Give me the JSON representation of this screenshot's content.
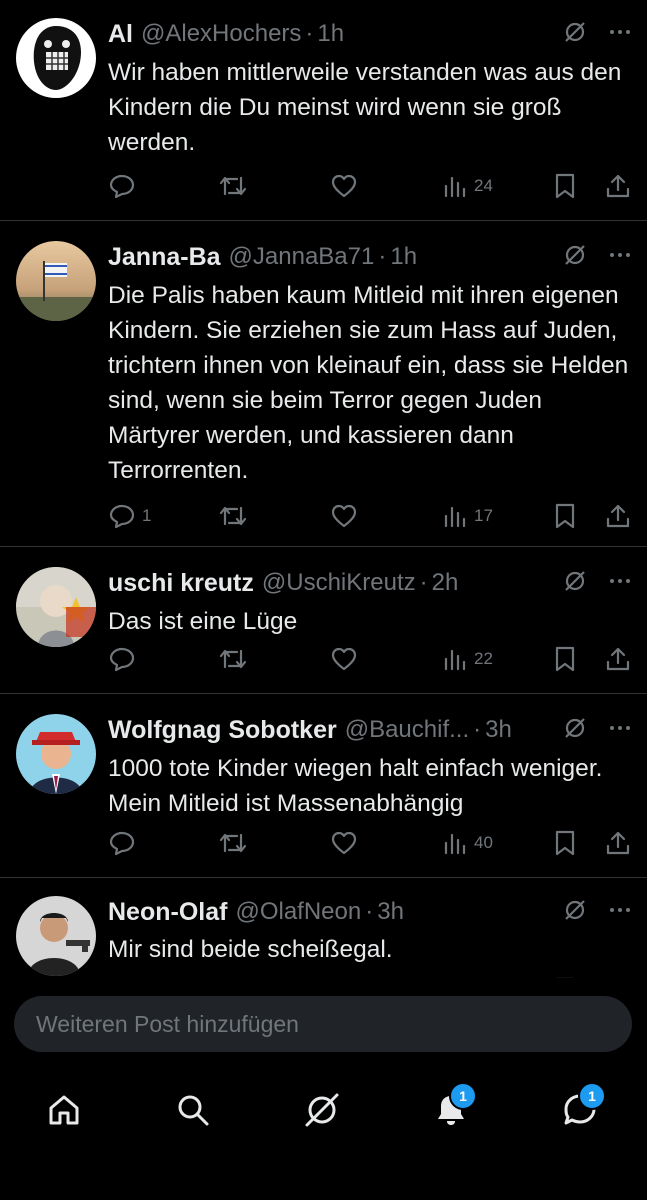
{
  "posts": [
    {
      "author": "Al",
      "handle": "@AlexHochers",
      "time": "1h",
      "text": "Wir haben mittlerweile verstanden was aus den Kindern die Du meinst wird wenn sie groß werden.",
      "replies": "",
      "views": "24"
    },
    {
      "author": "Janna-Ba",
      "handle": "@JannaBa71",
      "time": "1h",
      "text": "Die Palis haben kaum Mitleid mit ihren eigenen Kindern. Sie erziehen sie zum Hass auf Juden, trichtern ihnen von kleinauf ein, dass sie Helden sind, wenn sie beim Terror gegen Juden Märtyrer werden, und kassieren dann Terrorrenten.",
      "replies": "1",
      "views": "17"
    },
    {
      "author": "uschi kreutz",
      "handle": "@UschiKreutz",
      "time": "2h",
      "text": "Das ist eine Lüge",
      "replies": "",
      "views": "22"
    },
    {
      "author": "Wolfgnag Sobotker",
      "handle": "@Bauchif...",
      "time": "3h",
      "text": "1000 tote Kinder wiegen halt einfach weniger. Mein Mitleid ist Massenabhängig",
      "replies": "",
      "views": "40"
    },
    {
      "author": "Neon-Olaf",
      "handle": "@OlafNeon",
      "time": "3h",
      "text": "Mir sind beide scheißegal.",
      "replies": "",
      "views": ""
    }
  ],
  "separator": "·",
  "reply_box": {
    "placeholder": "Weiteren Post hinzufügen"
  },
  "nav": {
    "notifications_badge": "1",
    "messages_badge": "1"
  },
  "colors": {
    "background": "#000000",
    "text": "#e7e9ea",
    "muted": "#71767b",
    "accent": "#1d9bf0"
  },
  "icons": [
    "grok-icon",
    "more-icon",
    "reply-icon",
    "repost-icon",
    "like-icon",
    "views-icon",
    "bookmark-icon",
    "share-icon",
    "home-icon",
    "search-icon",
    "grok-nav-icon",
    "notifications-icon",
    "messages-icon"
  ]
}
